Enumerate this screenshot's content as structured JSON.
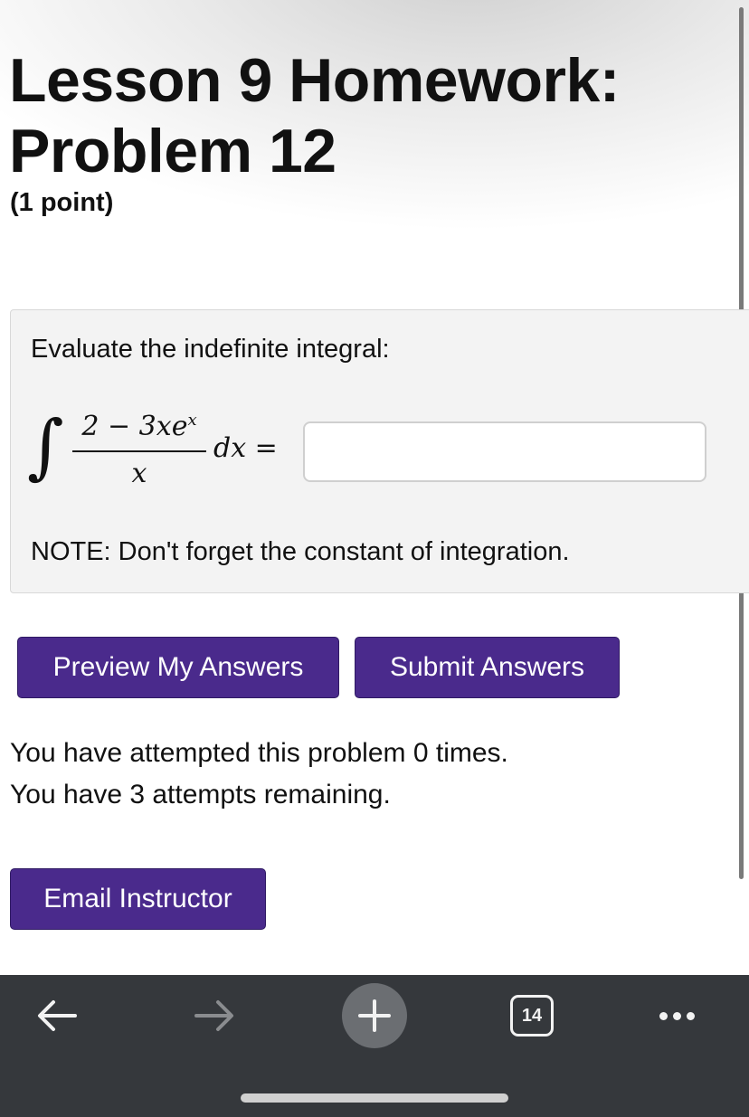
{
  "header": {
    "title": "Lesson 9 Homework: Problem 12",
    "points": "(1 point)"
  },
  "problem": {
    "prompt": "Evaluate the indefinite integral:",
    "integral": {
      "numerator": "2 − 3xe",
      "exponent": "x",
      "denominator": "x",
      "differential": "dx ="
    },
    "answer_value": "",
    "answer_placeholder": "",
    "note": "NOTE: Don't forget the constant of integration."
  },
  "actions": {
    "preview_label": "Preview My Answers",
    "submit_label": "Submit Answers",
    "email_label": "Email Instructor"
  },
  "attempts": {
    "line1": "You have attempted this problem 0 times.",
    "line2": "You have 3 attempts remaining."
  },
  "browser_bar": {
    "back_icon": "arrow-left-icon",
    "forward_icon": "arrow-right-icon",
    "new_tab_icon": "plus-icon",
    "tab_count": "14",
    "menu_icon": "more-dots-icon"
  },
  "colors": {
    "button_bg": "#4a2a8c",
    "toolbar_bg": "#35383c",
    "problem_bg": "#f3f3f3"
  }
}
